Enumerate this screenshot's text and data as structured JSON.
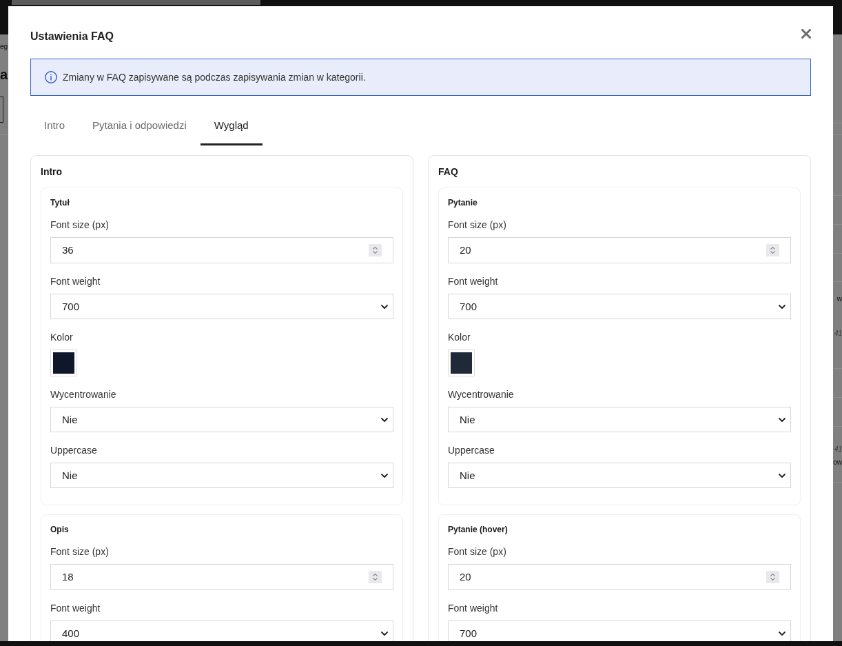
{
  "page": {
    "breadcrumb_fragment": "eg",
    "heading_fragment": "a",
    "right_fragments": [
      {
        "text": "w",
        "kind": "plain"
      },
      {
        "text": "41",
        "kind": "muted"
      },
      {
        "text": "41",
        "kind": "muted"
      },
      {
        "text": "ow",
        "kind": "plain"
      }
    ]
  },
  "dialog": {
    "title": "Ustawienia FAQ",
    "info": "Zmiany w FAQ zapisywane są podczas zapisywania zmian w kategorii.",
    "tabs": [
      {
        "label": "Intro",
        "selected": false
      },
      {
        "label": "Pytania i odpowiedzi",
        "selected": false
      },
      {
        "label": "Wygląd",
        "selected": true
      }
    ],
    "panels": [
      {
        "title": "Intro",
        "groups": [
          {
            "title": "Tytuł",
            "fields": [
              {
                "kind": "number",
                "label": "Font size (px)",
                "value": "36"
              },
              {
                "kind": "select",
                "label": "Font weight",
                "value": "700"
              },
              {
                "kind": "color",
                "label": "Kolor",
                "color": "#0f172a"
              },
              {
                "kind": "select",
                "label": "Wycentrowanie",
                "value": "Nie"
              },
              {
                "kind": "select",
                "label": "Uppercase",
                "value": "Nie"
              }
            ]
          },
          {
            "title": "Opis",
            "fields": [
              {
                "kind": "number",
                "label": "Font size (px)",
                "value": "18"
              },
              {
                "kind": "select",
                "label": "Font weight",
                "value": "400"
              }
            ]
          }
        ]
      },
      {
        "title": "FAQ",
        "groups": [
          {
            "title": "Pytanie",
            "fields": [
              {
                "kind": "number",
                "label": "Font size (px)",
                "value": "20"
              },
              {
                "kind": "select",
                "label": "Font weight",
                "value": "700"
              },
              {
                "kind": "color",
                "label": "Kolor",
                "color": "#1f2937"
              },
              {
                "kind": "select",
                "label": "Wycentrowanie",
                "value": "Nie"
              },
              {
                "kind": "select",
                "label": "Uppercase",
                "value": "Nie"
              }
            ]
          },
          {
            "title": "Pytanie (hover)",
            "fields": [
              {
                "kind": "number",
                "label": "Font size (px)",
                "value": "20"
              },
              {
                "kind": "select",
                "label": "Font weight",
                "value": "700"
              }
            ]
          }
        ]
      }
    ]
  }
}
